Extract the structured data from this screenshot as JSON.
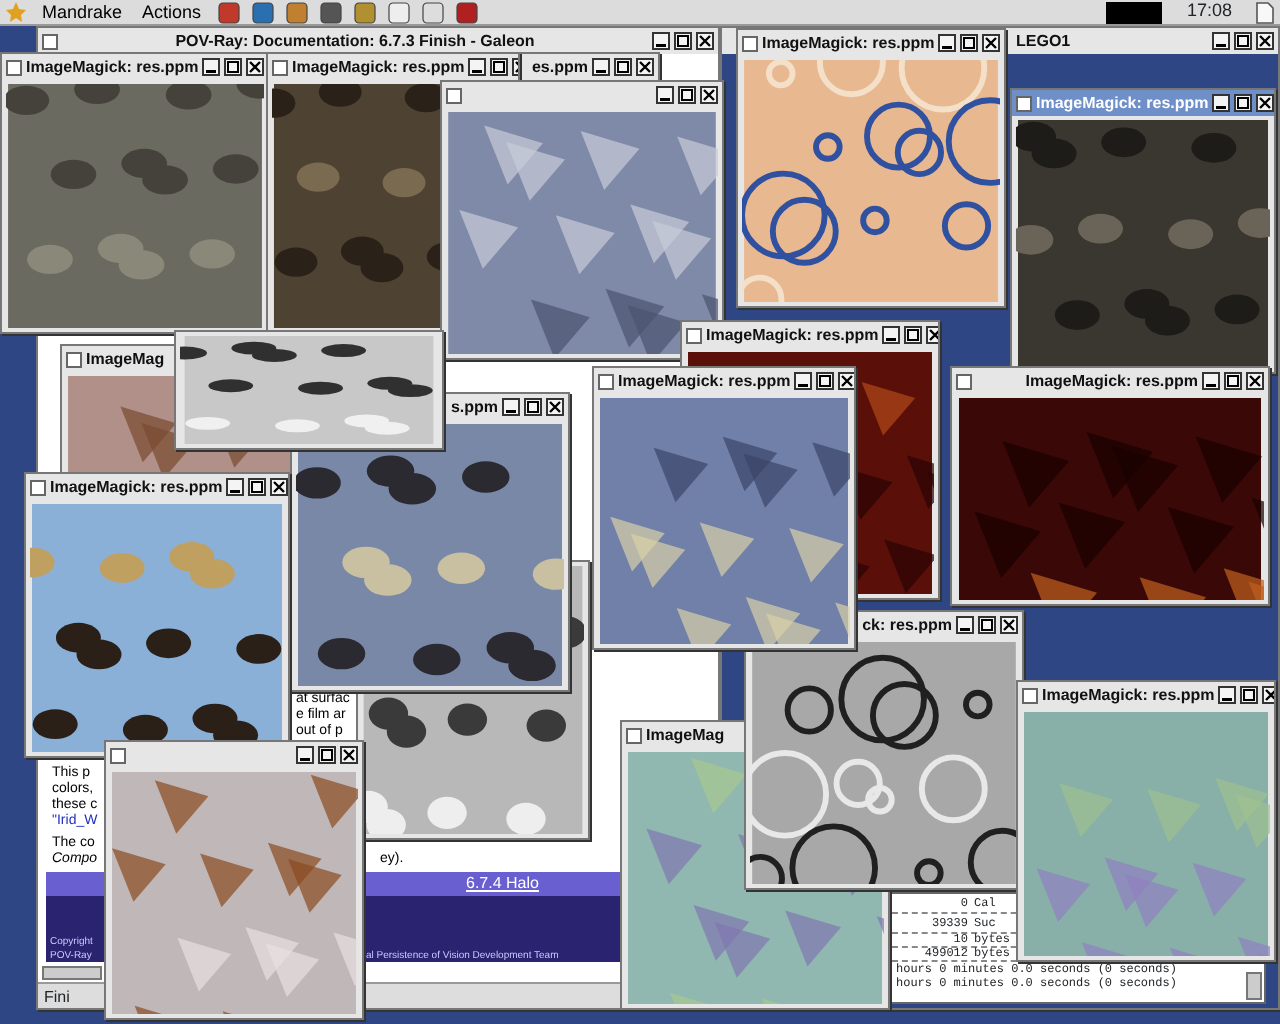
{
  "panel": {
    "menus": [
      "Mandrake",
      "Actions"
    ],
    "clock": "17:08"
  },
  "browser": {
    "title": "POV-Ray: Documentation: 6.7.3 Finish - Galeon",
    "texts": [
      {
        "kind": "plain",
        "text": "at surfac"
      },
      {
        "kind": "plain",
        "text": "e film ar"
      },
      {
        "kind": "plain",
        "text": "out of p"
      },
      {
        "kind": "plain",
        "text": "This p"
      },
      {
        "kind": "plain",
        "text": "colors,"
      },
      {
        "kind": "plain",
        "text": "these c"
      },
      {
        "kind": "code",
        "text": "\"Irid_W"
      },
      {
        "kind": "plain",
        "text": "The co"
      },
      {
        "kind": "italic",
        "text": "Compo"
      },
      {
        "kind": "plain",
        "text": "ey)."
      }
    ],
    "nav_link": "6.7.4 Halo",
    "footer": [
      "Copyright",
      "POV-Ray",
      "al Persistence of Vision Development Team"
    ],
    "status": "Fini"
  },
  "render_window": {
    "title": "LEGO1",
    "log": [
      {
        "num": "0",
        "word": "Cal"
      },
      {
        "num": "39339",
        "word": "Suc"
      },
      {
        "num": "10",
        "word": "bytes"
      },
      {
        "num": "499012",
        "word": "bytes"
      }
    ],
    "times": [
      "hours  0 minutes  0.0 seconds (0 seconds)",
      "hours  0 minutes  0.0 seconds (0 seconds)"
    ]
  },
  "viewers": [
    {
      "title": "ImageMagick: res.ppm",
      "active": false
    },
    {
      "title": "ImageMagick: res.ppm",
      "active": false
    },
    {
      "title": "ImageMagick: res.ppm",
      "active": false
    },
    {
      "title": "es.ppm",
      "active": false
    },
    {
      "active": false
    },
    {
      "title": "ImageMagick: res.ppm",
      "active": true
    },
    {
      "title": "ImageMagick: res.ppm",
      "active": false
    },
    {
      "active": false
    },
    {
      "title": "ImageMag",
      "active": false
    },
    {
      "title": "ImageMagick: res.ppm",
      "active": false
    },
    {
      "title": "ImageMagick: res.ppm",
      "active": false
    },
    {
      "title": "s.ppm",
      "active": false
    },
    {
      "title": "ImageMagick: res.ppm",
      "active": false
    },
    {
      "active": false
    },
    {
      "title": "ck: res.ppm",
      "active": false
    },
    {
      "title": "ImageMagick: res.ppm",
      "active": false
    },
    {
      "title": "ImageMag",
      "active": false
    },
    {
      "active": false
    }
  ]
}
